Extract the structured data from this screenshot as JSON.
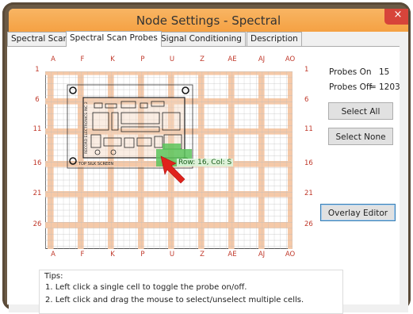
{
  "window": {
    "title": "Node Settings - Spectral",
    "close_glyph": "×"
  },
  "tabs": [
    {
      "label": "Spectral Scan"
    },
    {
      "label": "Spectral Scan Probes"
    },
    {
      "label": "Signal Conditioning"
    },
    {
      "label": "Description"
    }
  ],
  "grid": {
    "col_labels": [
      "A",
      "F",
      "K",
      "P",
      "U",
      "Z",
      "AE",
      "AJ",
      "AO"
    ],
    "row_labels": [
      "1",
      "6",
      "11",
      "16",
      "21",
      "26"
    ],
    "tooltip": "Row: 16, Col: S",
    "board_text": [
      "RECORD ELECTRONICS INC 2",
      "TOP SILK SCREEN"
    ]
  },
  "probes": {
    "on_label": "Probes On",
    "on_value": "15",
    "off_label": "Probes Off",
    "off_equals": "=",
    "off_value": "1203"
  },
  "buttons": {
    "select_all": "Select All",
    "select_none": "Select None",
    "overlay_editor": "Overlay Editor"
  },
  "tips": {
    "title": "Tips:",
    "items": [
      "1. Left click a single cell to toggle the probe on/off.",
      "2. Left click and drag the mouse to select/unselect multiple cells."
    ]
  },
  "colors": {
    "title_bar": "#f5a143",
    "close_button": "#d7443a",
    "grid_stripe": "#f5c9a8",
    "probe_on": "#5cc45c",
    "arrow": "#e0231c",
    "label_red": "#c0392b"
  }
}
